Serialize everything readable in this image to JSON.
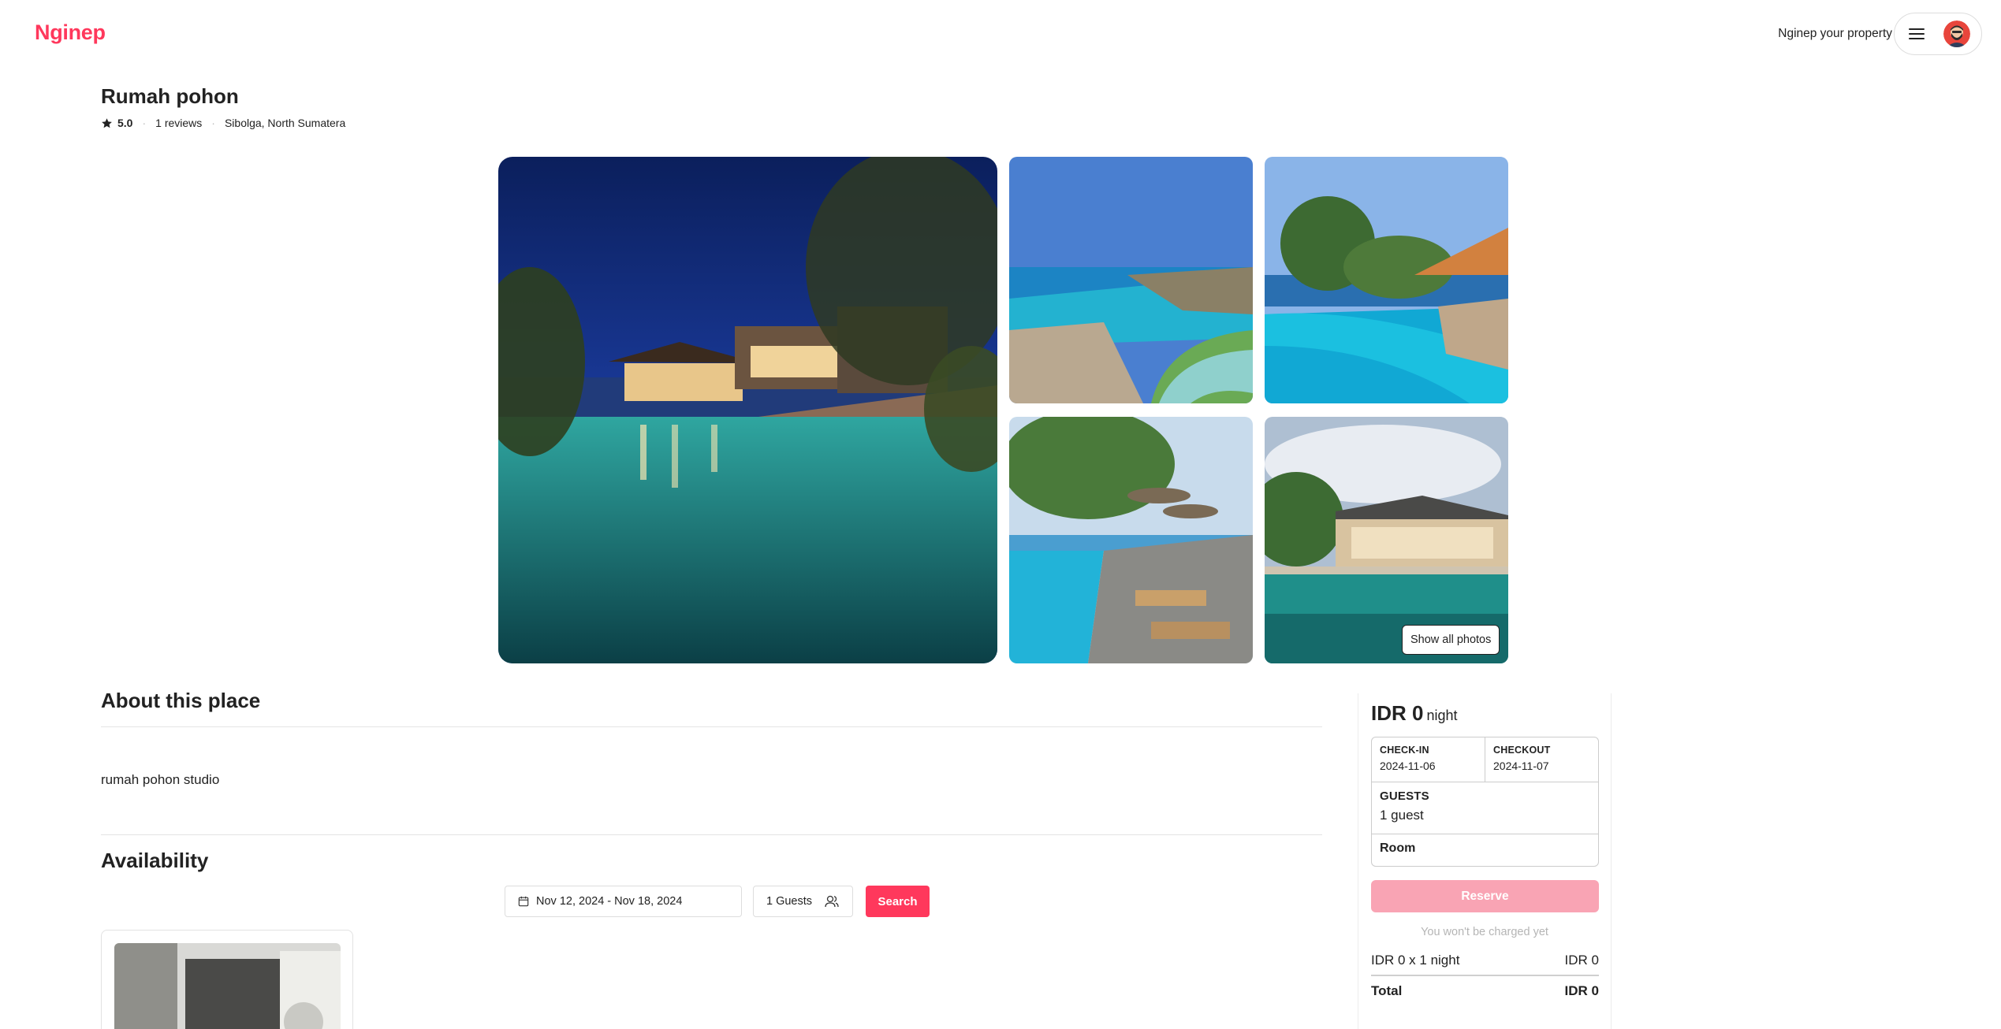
{
  "header": {
    "logo": "Nginep",
    "host_link": "Nginep your property"
  },
  "listing": {
    "title": "Rumah pohon",
    "rating": "5.0",
    "reviews": "1 reviews",
    "location": "Sibolga, North Sumatera",
    "show_all_photos": "Show all photos"
  },
  "about": {
    "title": "About this place",
    "description": "rumah pohon studio"
  },
  "availability": {
    "title": "Availability",
    "date_range": "Nov 12, 2024 - Nov 18, 2024",
    "guests": "1 Guests",
    "search_label": "Search"
  },
  "booking": {
    "price": "IDR 0",
    "per": "night",
    "checkin_label": "CHECK-IN",
    "checkin_value": "2024-11-06",
    "checkout_label": "CHECKOUT",
    "checkout_value": "2024-11-07",
    "guests_label": "GUESTS",
    "guests_value": "1 guest",
    "room_label": "Room",
    "reserve_label": "Reserve",
    "note": "You won't be charged yet",
    "line_label": "IDR 0 x 1 night",
    "line_value": "IDR 0",
    "total_label": "Total",
    "total_value": "IDR 0"
  },
  "colors": {
    "brand": "#ff385c",
    "reserve_disabled": "#f9a4b4"
  },
  "icons": [
    "hamburger-icon",
    "avatar",
    "star-icon",
    "calendar-icon",
    "users-icon"
  ]
}
